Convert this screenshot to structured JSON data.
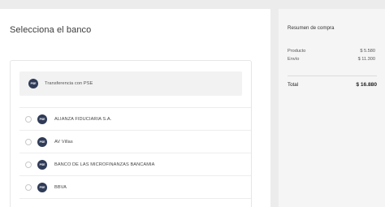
{
  "page": {
    "title": "Selecciona el banco"
  },
  "pse": {
    "logo_text": "PSE",
    "label": "Transferencia con PSE"
  },
  "banks": [
    {
      "logo_text": "PSE",
      "name": "ALIANZA FIDUCIARIA S.A."
    },
    {
      "logo_text": "PSE",
      "name": "AV Villas"
    },
    {
      "logo_text": "PSE",
      "name": "BANCO DE LAS MICROFINANZAS BANCAMIA"
    },
    {
      "logo_text": "PSE",
      "name": "BBVA"
    }
  ],
  "summary": {
    "title": "Resumen de compra",
    "items": [
      {
        "label": "Producto",
        "value": "$ 5.580"
      },
      {
        "label": "Envío",
        "value": "$ 11.300"
      }
    ],
    "total_label": "Total",
    "total_value": "$ 16.880"
  },
  "colors": {
    "logo": "#2f3b57",
    "background": "#ececec",
    "panel": "#f5f5f5"
  }
}
